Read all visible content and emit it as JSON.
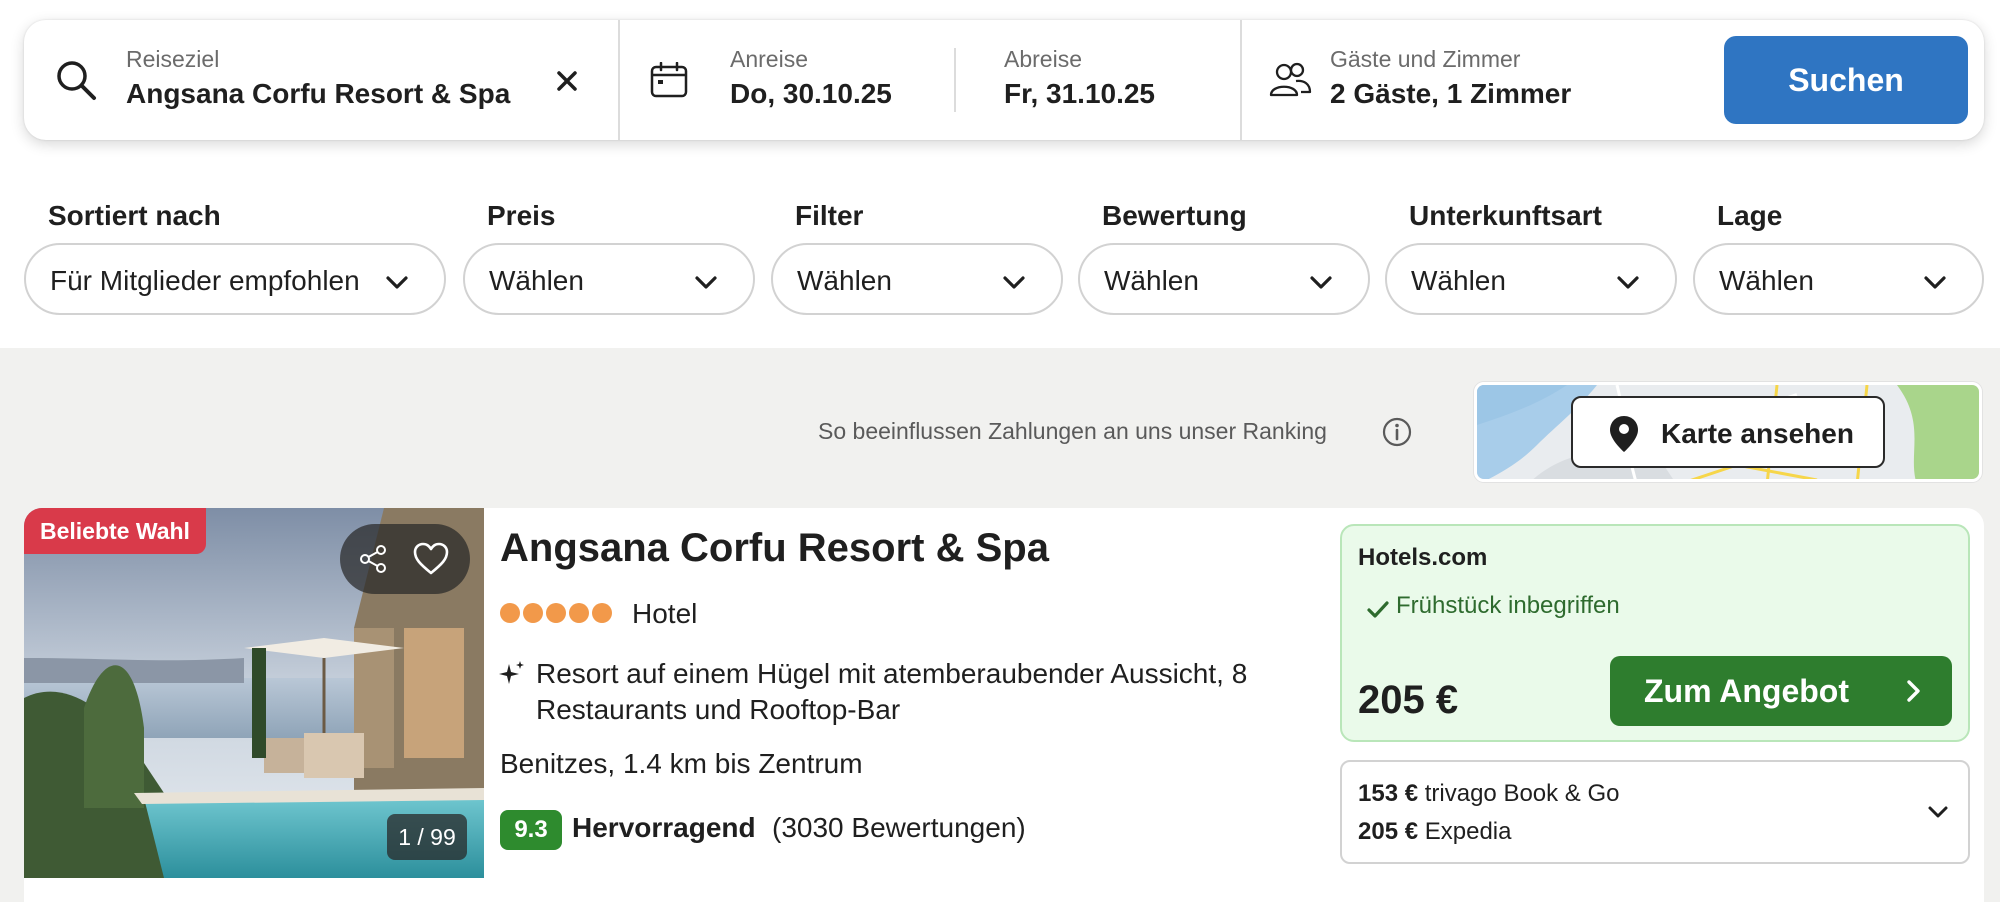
{
  "search": {
    "destination_label": "Reiseziel",
    "destination_value": "Angsana Corfu Resort & Spa",
    "checkin_label": "Anreise",
    "checkin_value": "Do, 30.10.25",
    "checkout_label": "Abreise",
    "checkout_value": "Fr, 31.10.25",
    "guests_label": "Gäste und Zimmer",
    "guests_value": "2 Gäste, 1 Zimmer",
    "search_button": "Suchen"
  },
  "filters": [
    {
      "title": "Sortiert nach",
      "value": "Für Mitglieder empfohlen"
    },
    {
      "title": "Preis",
      "value": "Wählen"
    },
    {
      "title": "Filter",
      "value": "Wählen"
    },
    {
      "title": "Bewertung",
      "value": "Wählen"
    },
    {
      "title": "Unterkunftsart",
      "value": "Wählen"
    },
    {
      "title": "Lage",
      "value": "Wählen"
    }
  ],
  "ranking_note": "So beeinflussen Zahlungen an uns unser Ranking",
  "map_button": "Karte ansehen",
  "hotel": {
    "badge": "Beliebte Wahl",
    "photo_counter": "1 / 99",
    "name": "Angsana Corfu Resort & Spa",
    "stars": 5,
    "type": "Hotel",
    "highlight": "Resort auf einem Hügel mit atemberaubender Aussicht, 8 Restaurants und Rooftop-Bar",
    "location": "Benitzes, 1.4 km bis Zentrum",
    "rating_score": "9.3",
    "rating_word": "Hervorragend",
    "rating_count": "(3030 Bewertungen)"
  },
  "offer": {
    "provider": "Hotels.com",
    "feature": "Frühstück inbegriffen",
    "price": "205 €",
    "button": "Zum Angebot"
  },
  "other_offers": [
    {
      "price": "153 €",
      "provider": "trivago Book & Go"
    },
    {
      "price": "205 €",
      "provider": "Expedia"
    }
  ],
  "colors": {
    "primary_blue": "#2f75c2",
    "deal_green": "#2e7d2e",
    "rating_green": "#2e8b2e",
    "badge_red": "#d93a4a",
    "star_orange": "#f2994a",
    "offer_bg": "#eafaea"
  }
}
